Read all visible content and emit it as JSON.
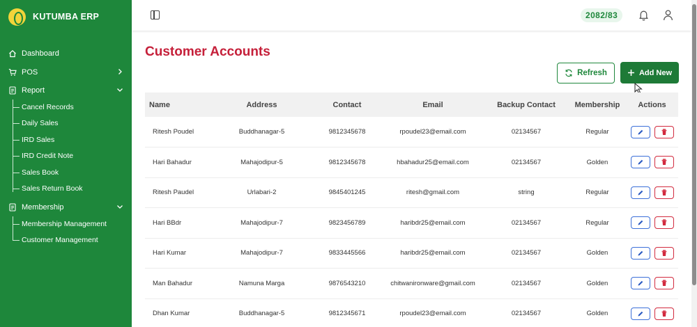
{
  "brand": {
    "name": "KUTUMBA ERP"
  },
  "sidebar": {
    "items": [
      {
        "label": "Dashboard",
        "icon": "home-icon"
      },
      {
        "label": "POS",
        "icon": "cart-icon"
      },
      {
        "label": "Report",
        "icon": "report-icon"
      },
      {
        "label": "Membership",
        "icon": "membership-icon"
      }
    ],
    "report_subitems": [
      "Cancel Records",
      "Daily Sales",
      "IRD Sales",
      "IRD Credit Note",
      "Sales Book",
      "Sales Return Book"
    ],
    "membership_subitems": [
      "Membership Management",
      "Customer Management"
    ]
  },
  "header": {
    "fiscal_year": "2082/83"
  },
  "page": {
    "title": "Customer Accounts",
    "refresh_label": "Refresh",
    "add_label": "Add New"
  },
  "colors": {
    "sidebar": "#1e873b",
    "title": "#c5203a",
    "edit": "#3b6fd8",
    "delete": "#d22a3e"
  },
  "table": {
    "headers": [
      "Name",
      "Address",
      "Contact",
      "Email",
      "Backup Contact",
      "Membership",
      "Actions"
    ],
    "rows": [
      [
        "Ritesh Poudel",
        "Buddhanagar-5",
        "9812345678",
        "rpoudel23@email.com",
        "02134567",
        "Regular"
      ],
      [
        "Hari Bahadur",
        "Mahajodipur-5",
        "9812345678",
        "hbahadur25@email.com",
        "02134567",
        "Golden"
      ],
      [
        "Ritesh Paudel",
        "Urlabari-2",
        "9845401245",
        "ritesh@gmail.com",
        "string",
        "Regular"
      ],
      [
        "Hari BBdr",
        "Mahajodipur-7",
        "9823456789",
        "haribdr25@email.com",
        "02134567",
        "Regular"
      ],
      [
        "Hari Kumar",
        "Mahajodipur-7",
        "9833445566",
        "haribdr25@email.com",
        "02134567",
        "Golden"
      ],
      [
        "Man Bahadur",
        "Namuna Marga",
        "9876543210",
        "chitwanironware@gmail.com",
        "02134567",
        "Golden"
      ],
      [
        "Dhan Kumar",
        "Buddhanagar-5",
        "9812345671",
        "rpoudel23@email.com",
        "02134567",
        "Golden"
      ]
    ]
  }
}
